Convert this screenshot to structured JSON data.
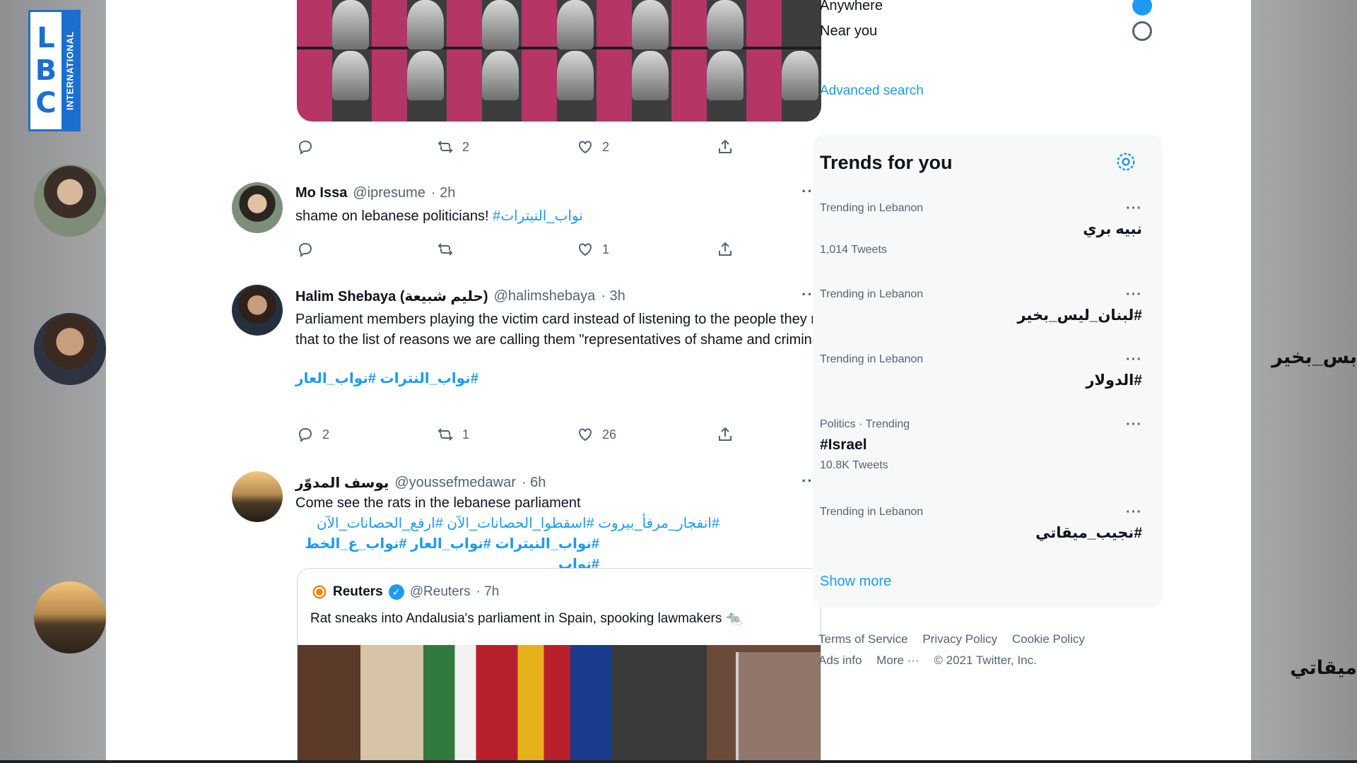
{
  "channel": {
    "letters": [
      "L",
      "B",
      "C"
    ],
    "sub": "INTERNATIONAL",
    "color": "#1b6fd1"
  },
  "background_text": {
    "right_top": "بس_بخير",
    "right_bottom": "ميقاتي"
  },
  "feed": {
    "top_tweet_actions": {
      "reply": "",
      "retweet": "2",
      "like": "2"
    },
    "tweets": [
      {
        "name": "Mo Issa",
        "handle": "@ipresume",
        "time": "· 2h",
        "text": "shame on lebanese politicians! ",
        "hashtag": "#نواب_النيترات",
        "actions": {
          "reply": "",
          "retweet": "",
          "like": "1"
        }
      },
      {
        "name": "Halim Shebaya (حليم شبيعة)",
        "handle": "@halimshebaya",
        "time": "· 3h",
        "text": "Parliament members playing the victim card instead of listening to the people they represent. Add that to the list of reasons we are calling them \"representatives of shame and criminality\". Tfeh.",
        "hashtag_line": "#نواب_النترات #نواب_العار",
        "actions": {
          "reply": "2",
          "retweet": "1",
          "like": "26"
        }
      },
      {
        "name": "يوسف المدوّر",
        "handle": "@youssefmedawar",
        "time": "· 6h",
        "text": "Come see the rats in the lebanese parliament",
        "hashtag_line_1": "#انفجار_مرفأ_بيروت #اسقطوا_الحصانات_الآن #ارفع_الحصانات_الآن",
        "hashtag_line_2": "#نواب_النيترات #نواب_العار #نواب_ع_الخط #نواب"
      }
    ],
    "quote": {
      "name": "Reuters",
      "handle": "@Reuters",
      "time": "· 7h",
      "text": "Rat sneaks into Andalusia's parliament in Spain, spooking lawmakers 🐀"
    }
  },
  "sidebar": {
    "locations": [
      {
        "label": "Anywhere",
        "selected": true
      },
      {
        "label": "Near you",
        "selected": false
      }
    ],
    "advanced_search": "Advanced search",
    "trends_title": "Trends for you",
    "trends": [
      {
        "context": "Trending in Lebanon",
        "name": "نبيه بري",
        "count": "1,014 Tweets"
      },
      {
        "context": "Trending in Lebanon",
        "name": "#لبنان_ليس_بخير",
        "count": ""
      },
      {
        "context": "Trending in Lebanon",
        "name": "#الدولار",
        "count": ""
      },
      {
        "context": "Politics · Trending",
        "name": "#Israel",
        "count": "10.8K Tweets"
      },
      {
        "context": "Trending in Lebanon",
        "name": "#نجيب_ميقاتي",
        "count": ""
      }
    ],
    "show_more": "Show more",
    "footer": {
      "row1": [
        "Terms of Service",
        "Privacy Policy",
        "Cookie Policy"
      ],
      "row2": [
        "Ads info",
        "More ···",
        "© 2021 Twitter, Inc."
      ]
    },
    "accent_color": "#1d9bf0"
  }
}
